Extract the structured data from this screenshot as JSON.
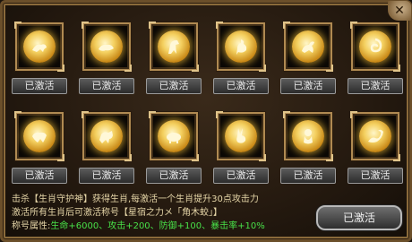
{
  "close_label": "✕",
  "slots": [
    {
      "icon": "tiger-icon",
      "button": "已激活"
    },
    {
      "icon": "rat-icon",
      "button": "已激活"
    },
    {
      "icon": "horse-icon",
      "button": "已激活"
    },
    {
      "icon": "rooster-icon",
      "button": "已激活"
    },
    {
      "icon": "goat-icon",
      "button": "已激活"
    },
    {
      "icon": "snake-icon",
      "button": "已激活"
    },
    {
      "icon": "ox-icon",
      "button": "已激活"
    },
    {
      "icon": "dog-icon",
      "button": "已激活"
    },
    {
      "icon": "pig-icon",
      "button": "已激活"
    },
    {
      "icon": "rabbit-icon",
      "button": "已激活"
    },
    {
      "icon": "monkey-icon",
      "button": "已激活"
    },
    {
      "icon": "dragon-icon",
      "button": "已激活"
    }
  ],
  "info": {
    "line1_prefix": "击杀【生肖守护神】获得生肖,每激活一个生肖提升30点攻击力",
    "line2": "激活所有生肖后可激活称号【星宿之力メ「角木蛟」】",
    "line3_label": "称号属性:",
    "line3_values": "生命+6000、攻击+200、防御+100、暴击率+10%"
  },
  "main_button": "已激活",
  "colors": {
    "text_gold": "#e6d6a8",
    "text_green": "#48e048",
    "frame": "#6b4f2a"
  }
}
